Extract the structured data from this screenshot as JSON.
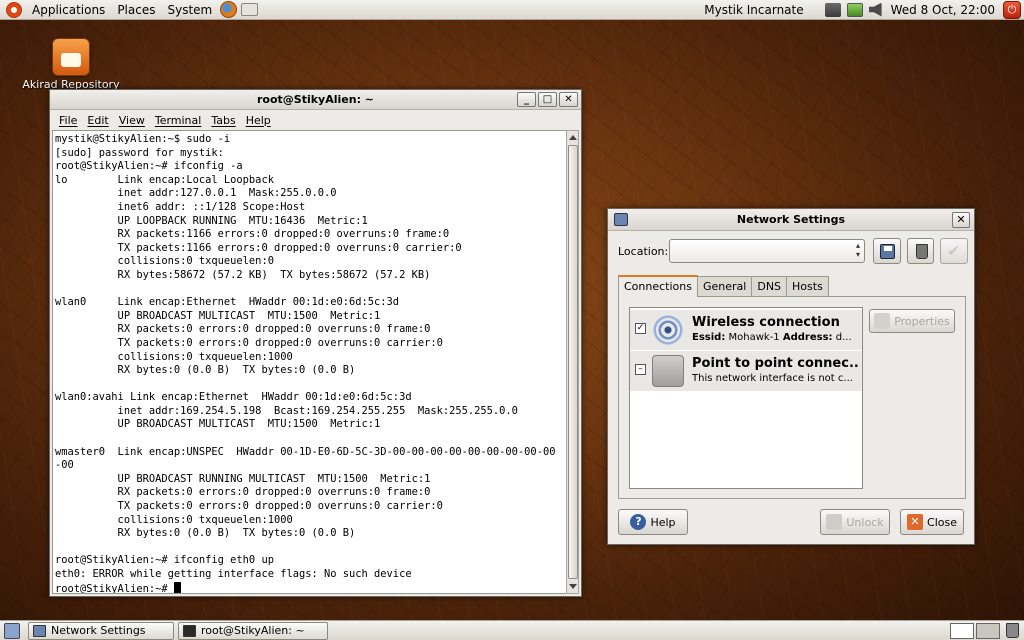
{
  "top_panel": {
    "menus": [
      "Applications",
      "Places",
      "System"
    ],
    "user": "Mystik Incarnate",
    "clock": "Wed  8 Oct, 22:00"
  },
  "desktop": {
    "icons": [
      {
        "label": "Akirad Repository",
        "icon": "package-repository-icon"
      }
    ]
  },
  "terminal": {
    "title": "root@StikyAlien: ~",
    "menu": [
      "File",
      "Edit",
      "View",
      "Terminal",
      "Tabs",
      "Help"
    ],
    "lines": [
      "mystik@StikyAlien:~$ sudo -i",
      "[sudo] password for mystik:",
      "root@StikyAlien:~# ifconfig -a",
      "lo        Link encap:Local Loopback",
      "          inet addr:127.0.0.1  Mask:255.0.0.0",
      "          inet6 addr: ::1/128 Scope:Host",
      "          UP LOOPBACK RUNNING  MTU:16436  Metric:1",
      "          RX packets:1166 errors:0 dropped:0 overruns:0 frame:0",
      "          TX packets:1166 errors:0 dropped:0 overruns:0 carrier:0",
      "          collisions:0 txqueuelen:0",
      "          RX bytes:58672 (57.2 KB)  TX bytes:58672 (57.2 KB)",
      "",
      "wlan0     Link encap:Ethernet  HWaddr 00:1d:e0:6d:5c:3d",
      "          UP BROADCAST MULTICAST  MTU:1500  Metric:1",
      "          RX packets:0 errors:0 dropped:0 overruns:0 frame:0",
      "          TX packets:0 errors:0 dropped:0 overruns:0 carrier:0",
      "          collisions:0 txqueuelen:1000",
      "          RX bytes:0 (0.0 B)  TX bytes:0 (0.0 B)",
      "",
      "wlan0:avahi Link encap:Ethernet  HWaddr 00:1d:e0:6d:5c:3d",
      "          inet addr:169.254.5.198  Bcast:169.254.255.255  Mask:255.255.0.0",
      "          UP BROADCAST MULTICAST  MTU:1500  Metric:1",
      "",
      "wmaster0  Link encap:UNSPEC  HWaddr 00-1D-E0-6D-5C-3D-00-00-00-00-00-00-00-00-00",
      "-00",
      "          UP BROADCAST RUNNING MULTICAST  MTU:1500  Metric:1",
      "          RX packets:0 errors:0 dropped:0 overruns:0 frame:0",
      "          TX packets:0 errors:0 dropped:0 overruns:0 carrier:0",
      "          collisions:0 txqueuelen:1000",
      "          RX bytes:0 (0.0 B)  TX bytes:0 (0.0 B)",
      "",
      "root@StikyAlien:~# ifconfig eth0 up",
      "eth0: ERROR while getting interface flags: No such device",
      "root@StikyAlien:~# "
    ]
  },
  "network_settings": {
    "title": "Network Settings",
    "location_label": "Location:",
    "location_value": "",
    "tabs": [
      "Connections",
      "General",
      "DNS",
      "Hosts"
    ],
    "connections": [
      {
        "name": "Wireless connection",
        "detail_key1": "Essid:",
        "detail_val1": "Mohawk-1",
        "detail_key2": "Address:",
        "detail_val2": "d...",
        "checked": "✓",
        "icon": "wireless-antenna-icon"
      },
      {
        "name": "Point to point connec...",
        "detail": "This network interface is not c...",
        "checked": "–",
        "icon": "phone-modem-icon"
      }
    ],
    "properties_label": "Properties",
    "help_label": "Help",
    "unlock_label": "Unlock",
    "close_label": "Close"
  },
  "bottom_panel": {
    "tasks": [
      "Network Settings",
      "root@StikyAlien: ~"
    ]
  }
}
